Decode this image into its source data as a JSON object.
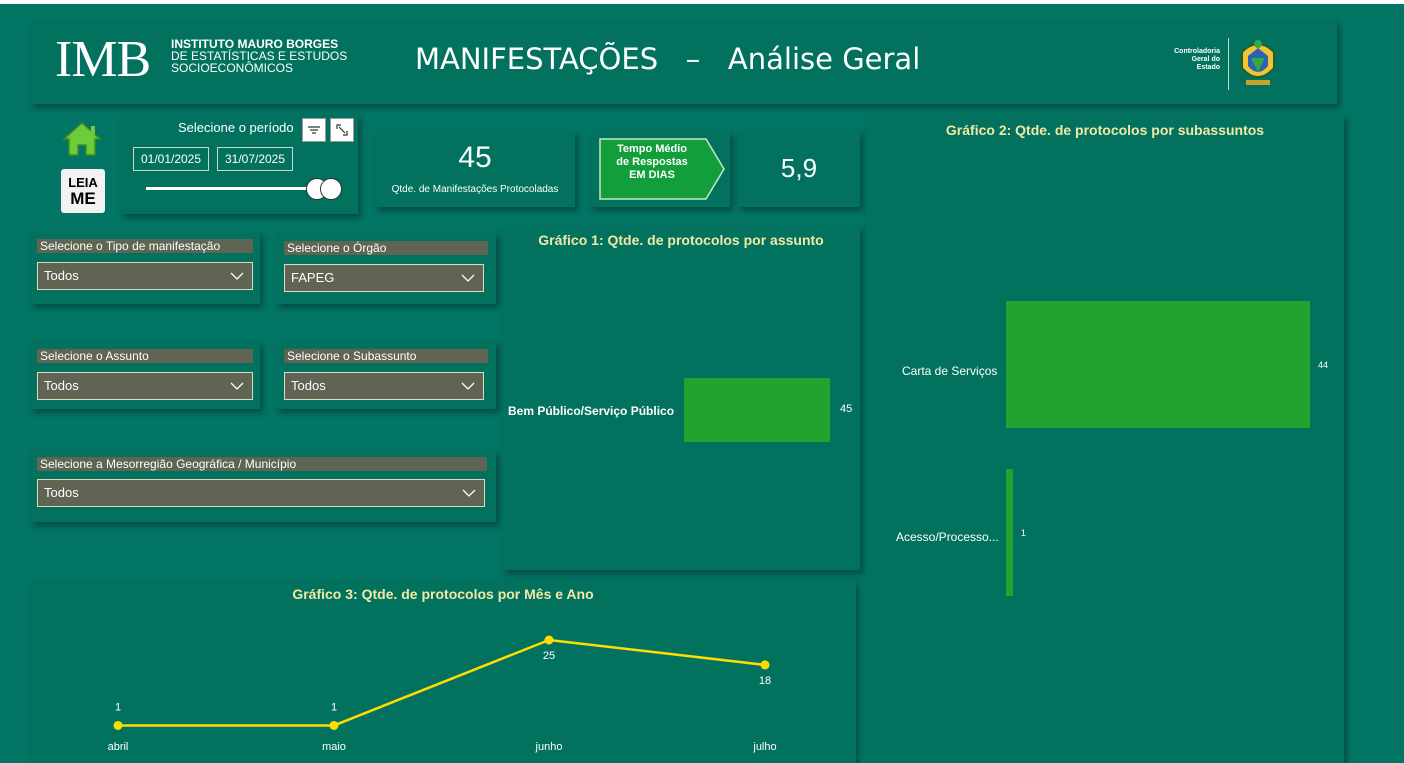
{
  "header": {
    "logo_letters": "IMB",
    "logo_line1": "INSTITUTO MAURO BORGES",
    "logo_line2": "DE ESTATÍSTICAS E ESTUDOS",
    "logo_line3": "SOCIOECONÔMICOS",
    "title": "MANIFESTAÇÕES   –   Análise Geral",
    "cge_line1": "Controladoria",
    "cge_line2": "Geral do",
    "cge_line3": "Estado"
  },
  "sidebar": {
    "home_icon": "home-icon",
    "readme_line1": "LEIA",
    "readme_line2": "ME"
  },
  "period": {
    "label": "Selecione o período",
    "start_date": "01/01/2025",
    "end_date": "31/07/2025",
    "slider_position": 1.0
  },
  "kpis": {
    "count_value": "45",
    "count_label": "Qtde. de Manifestações Protocoladas",
    "avg_tag_line1": "Tempo Médio",
    "avg_tag_line2": "de Respostas",
    "avg_tag_line3": "EM DIAS",
    "avg_value": "5,9"
  },
  "filters": {
    "tipo": {
      "label": "Selecione o Tipo de manifestação",
      "value": "Todos"
    },
    "orgao": {
      "label": "Selecione o Órgão",
      "value": "FAPEG"
    },
    "assunto": {
      "label": "Selecione o Assunto",
      "value": "Todos"
    },
    "subassunto": {
      "label": "Selecione o Subassunto",
      "value": "Todos"
    },
    "mesorregiao": {
      "label": "Selecione a Mesorregião Geográfica / Município",
      "value": "Todos"
    }
  },
  "colors": {
    "background": "#037565",
    "bar": "#22a22e",
    "line": "#ffdd00",
    "title": "#f2e8a4"
  },
  "chart_data": [
    {
      "type": "bar",
      "orientation": "horizontal",
      "title": "Gráfico 1: Qtde. de protocolos por assunto",
      "categories": [
        "Bem Público/Serviço Público"
      ],
      "values": [
        45
      ],
      "data_labels": [
        "45"
      ],
      "xlim": [
        0,
        45
      ]
    },
    {
      "type": "bar",
      "orientation": "horizontal",
      "title": "Gráfico 2: Qtde. de protocolos por subassuntos",
      "categories": [
        "Carta de Serviços",
        "Acesso/Processo..."
      ],
      "values": [
        44,
        1
      ],
      "data_labels": [
        "44",
        "1"
      ],
      "xlim": [
        0,
        44
      ]
    },
    {
      "type": "line",
      "title": "Gráfico 3: Qtde. de protocolos por Mês e Ano",
      "categories": [
        "abril",
        "maio",
        "junho",
        "julho"
      ],
      "values": [
        1,
        1,
        25,
        18
      ],
      "data_labels": [
        "1",
        "1",
        "25",
        "18"
      ],
      "ylim": [
        0,
        25
      ]
    }
  ]
}
